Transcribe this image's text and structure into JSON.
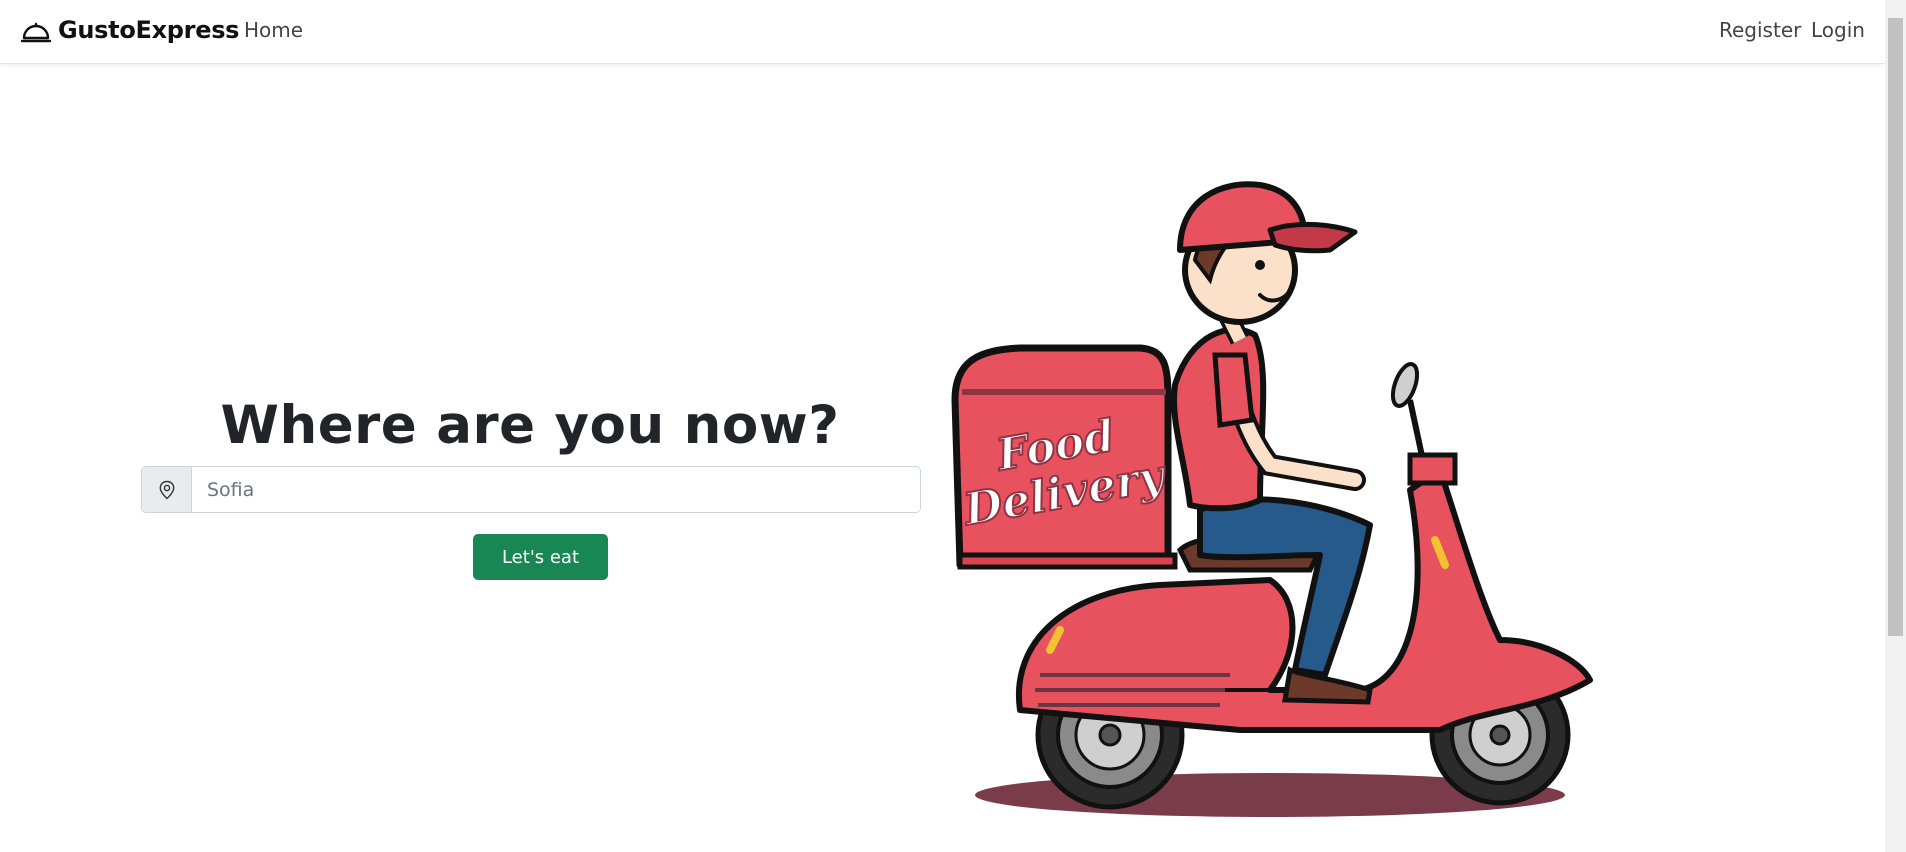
{
  "navbar": {
    "brand": "GustoExpress",
    "brand_icon": "cloche-icon",
    "home": "Home",
    "register": "Register",
    "login": "Login"
  },
  "hero": {
    "title": "Where are you now?",
    "location_icon": "location-pin-icon",
    "search_placeholder": "Sofia",
    "search_value": "",
    "submit_label": "Let's eat"
  },
  "illustration": {
    "box_text_line1": "Food",
    "box_text_line2": "Delivery"
  },
  "colors": {
    "primary_button": "#198754",
    "scooter_red": "#e8515e",
    "jeans_blue": "#265a8a"
  }
}
